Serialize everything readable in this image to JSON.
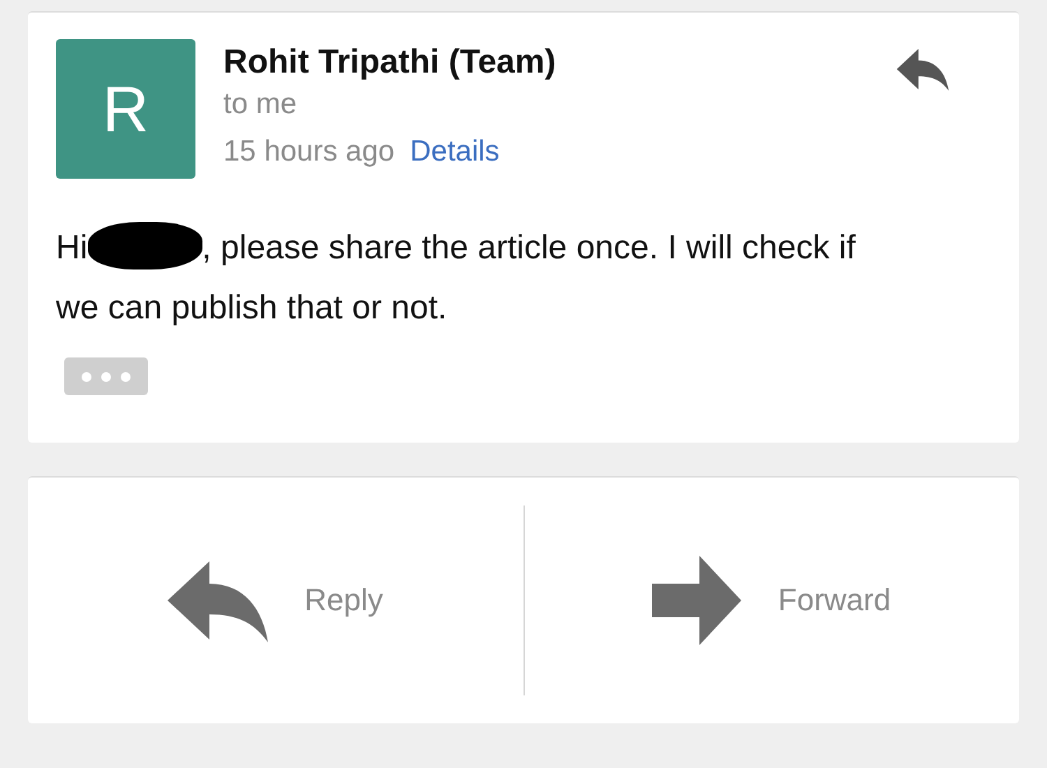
{
  "message": {
    "avatar_letter": "R",
    "sender": "Rohit Tripathi (Team)",
    "recipient": "to me",
    "time": "15 hours ago",
    "details_link": "Details",
    "greeting": "Hi",
    "body_lines": [
      ", please share the article once. I will check if",
      "we can publish that or not."
    ]
  },
  "actions": [
    {
      "label": "Reply",
      "kind": "reply"
    },
    {
      "label": "Forward",
      "kind": "forward"
    }
  ]
}
